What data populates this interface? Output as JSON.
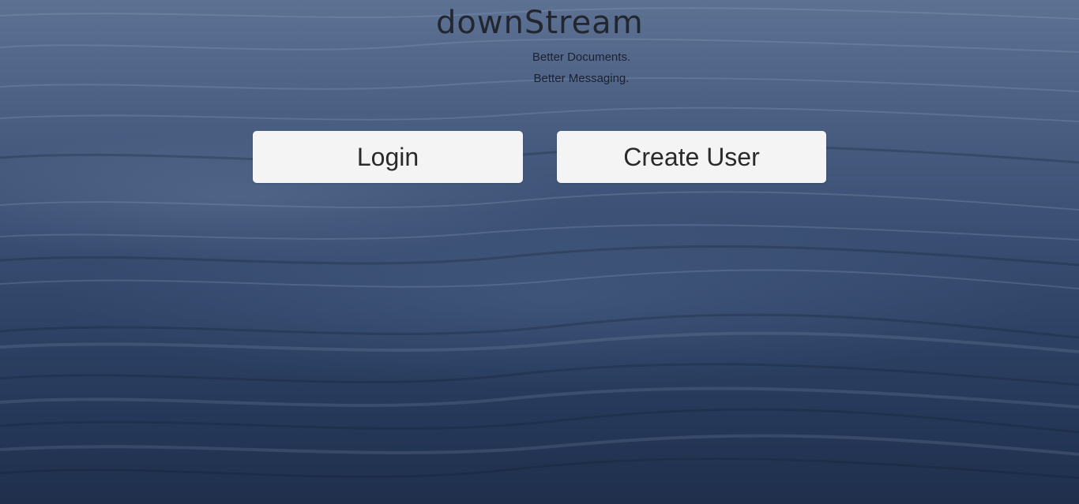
{
  "app": {
    "title": "downStream",
    "tagline_line1": "Better Documents.",
    "tagline_line2": "Better Messaging."
  },
  "actions": {
    "login_label": "Login",
    "create_user_label": "Create User"
  },
  "colors": {
    "button_bg": "#f4f4f4",
    "title_text": "#22272f",
    "water_light": "#5d7193",
    "water_dark": "#1f2f4c"
  }
}
